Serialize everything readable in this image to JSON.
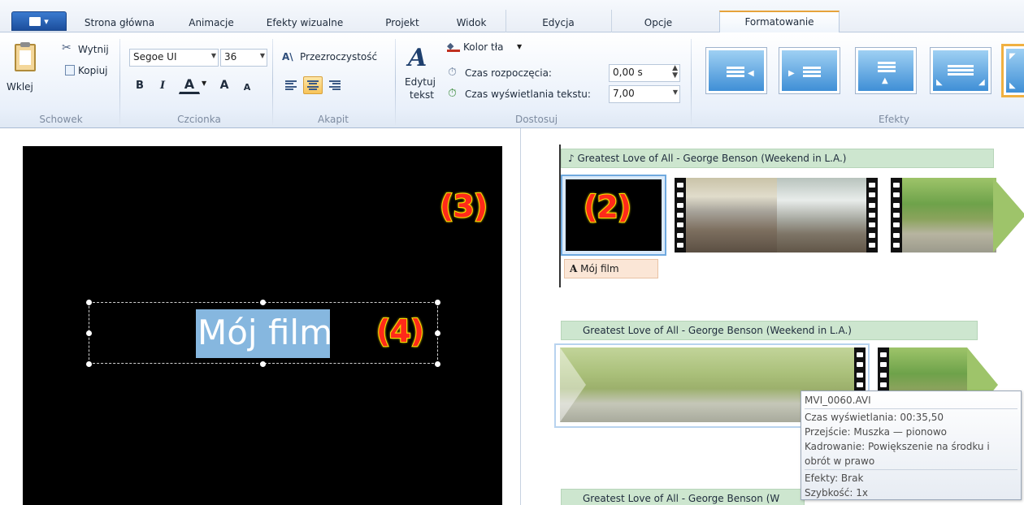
{
  "tabs": [
    "Strona główna",
    "Animacje",
    "Efekty wizualne",
    "Projekt",
    "Widok",
    "Edycja",
    "Opcje",
    "Formatowanie"
  ],
  "ribbon": {
    "schowek": {
      "label": "Schowek",
      "paste": "Wklej",
      "cut": "Wytnij",
      "copy": "Kopiuj"
    },
    "czcionka": {
      "label": "Czcionka",
      "font": "Segoe UI",
      "size": "36",
      "bold": "B",
      "italic": "I",
      "color": "A",
      "grow": "A",
      "shrink": "A"
    },
    "akapit": {
      "label": "Akapit",
      "transparency": "Przezroczystość"
    },
    "dostosuj": {
      "label": "Dostosuj",
      "edit_text_line1": "Edytuj",
      "edit_text_line2": "tekst",
      "bg_color": "Kolor tła",
      "start_time_label": "Czas rozpoczęcia:",
      "start_time_value": "0,00 s",
      "duration_label": "Czas wyświetlania tekstu:",
      "duration_value": "7,00"
    },
    "efekty": {
      "label": "Efekty"
    }
  },
  "preview": {
    "caption": "Mój film",
    "marker3": "(3)",
    "marker4": "(4)"
  },
  "storyboard": {
    "music1": "Greatest Love of All - George Benson (Weekend in L.A.)",
    "music2": "Greatest Love of All - George Benson (Weekend in L.A.)",
    "music3": "Greatest Love of All - George Benson (W",
    "marker2": "(2)",
    "caption_tag_icon": "A",
    "caption_tag_text": "Mój film"
  },
  "tooltip": {
    "filename": "MVI_0060.AVI",
    "duration": "Czas wyświetlania: 00:35,50",
    "transition": "Przejście: Muszka — pionowo",
    "framing1": "Kadrowanie: Powiększenie na środku i",
    "framing2": "obrót w prawo",
    "effects": "Efekty: Brak",
    "speed": "Szybkość: 1x"
  },
  "colors": {
    "accent": "#e6a33b",
    "selection": "#86b7df",
    "music_bar": "#cde6cf",
    "marker": "#ff2a1a"
  }
}
